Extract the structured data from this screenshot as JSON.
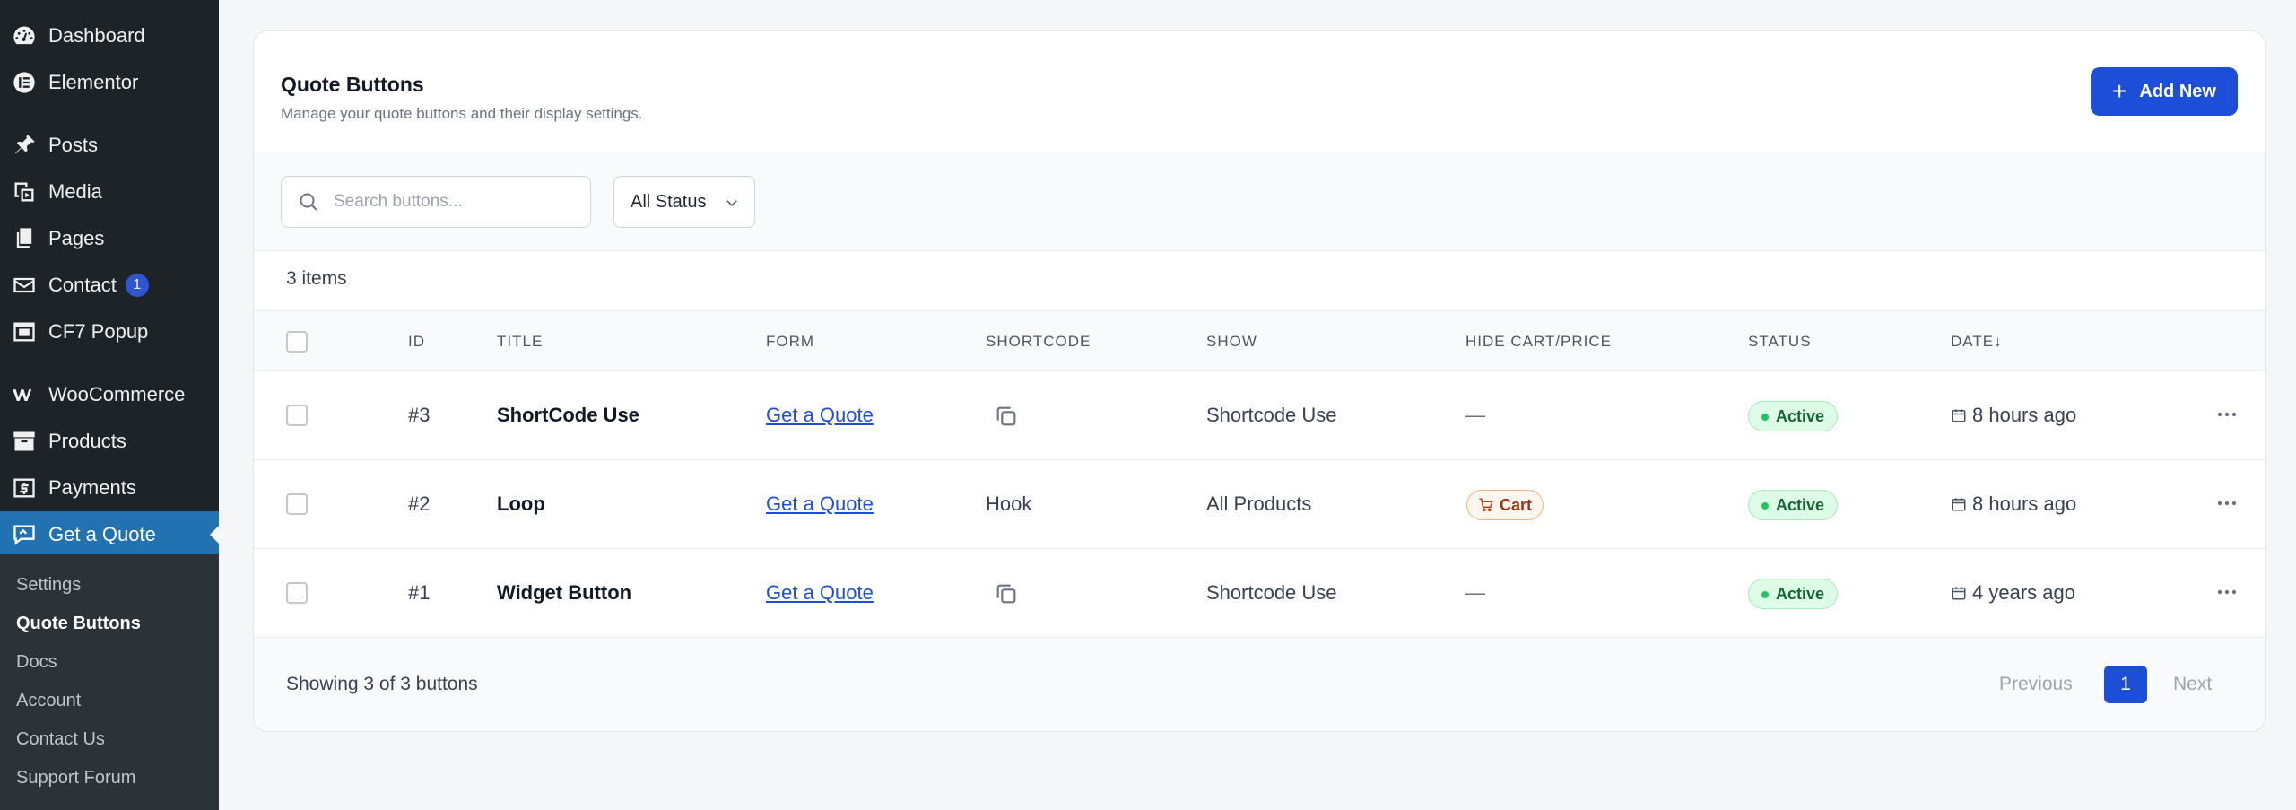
{
  "sidebar": {
    "items": [
      {
        "label": "Dashboard",
        "icon": "dashboard-icon"
      },
      {
        "label": "Elementor",
        "icon": "elementor-icon"
      },
      {
        "label": "Posts",
        "icon": "pin-icon"
      },
      {
        "label": "Media",
        "icon": "media-icon"
      },
      {
        "label": "Pages",
        "icon": "pages-icon"
      },
      {
        "label": "Contact",
        "icon": "mail-icon",
        "badge": "1"
      },
      {
        "label": "CF7 Popup",
        "icon": "popup-icon"
      },
      {
        "label": "WooCommerce",
        "icon": "woocommerce-icon"
      },
      {
        "label": "Products",
        "icon": "archive-icon"
      },
      {
        "label": "Payments",
        "icon": "dollar-icon"
      },
      {
        "label": "Get a Quote",
        "icon": "quote-chat-icon"
      }
    ],
    "submenu": [
      "Settings",
      "Quote Buttons",
      "Docs",
      "Account",
      "Contact Us",
      "Support Forum"
    ]
  },
  "header": {
    "title": "Quote Buttons",
    "subtitle": "Manage your quote buttons and their display settings.",
    "add_label": "Add New"
  },
  "filters": {
    "search_placeholder": "Search buttons...",
    "status_value": "All Status"
  },
  "items_count": "3 items",
  "table": {
    "columns": [
      "ID",
      "TITLE",
      "FORM",
      "SHORTCODE",
      "SHOW",
      "HIDE CART/PRICE",
      "STATUS",
      "DATE↓"
    ],
    "rows": [
      {
        "id": "#3",
        "title": "ShortCode Use",
        "form": "Get a Quote",
        "shortcode": "",
        "show": "Shortcode Use",
        "hide": "—",
        "status": "Active",
        "date": "8 hours ago"
      },
      {
        "id": "#2",
        "title": "Loop",
        "form": "Get a Quote",
        "shortcode": "Hook",
        "show": "All Products",
        "hide": "Cart",
        "status": "Active",
        "date": "8 hours ago"
      },
      {
        "id": "#1",
        "title": "Widget Button",
        "form": "Get a Quote",
        "shortcode": "",
        "show": "Shortcode Use",
        "hide": "—",
        "status": "Active",
        "date": "4 years ago"
      }
    ]
  },
  "footer": {
    "showing": "Showing 3 of 3 buttons",
    "prev": "Previous",
    "page": "1",
    "next": "Next"
  },
  "colors": {
    "sidebar_bg": "#1d2327",
    "accent": "#1d4ed8",
    "active_green": "#22c55e"
  }
}
